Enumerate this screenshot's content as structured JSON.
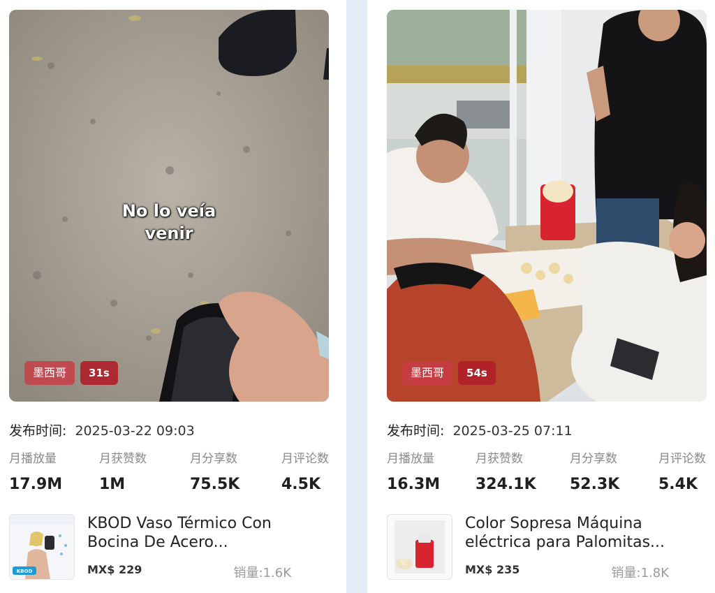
{
  "cards": [
    {
      "overlay_caption": "No lo veía\nvenir",
      "country": "墨西哥",
      "duration": "31s",
      "publish_label": "发布时间:",
      "publish_time": "2025-03-22 09:03",
      "stats": [
        {
          "label": "月播放量",
          "value": "17.9M"
        },
        {
          "label": "月获赞数",
          "value": "1M"
        },
        {
          "label": "月分享数",
          "value": "75.5K"
        },
        {
          "label": "月评论数",
          "value": "4.5K"
        }
      ],
      "product": {
        "title": "KBOD Vaso Térmico Con Bocina De Acero...",
        "price": "MX$ 229",
        "sales": "销量:1.6K",
        "image_logo": "KBOD"
      }
    },
    {
      "country": "墨西哥",
      "duration": "54s",
      "publish_label": "发布时间:",
      "publish_time": "2025-03-25 07:11",
      "stats": [
        {
          "label": "月播放量",
          "value": "16.3M"
        },
        {
          "label": "月获赞数",
          "value": "324.1K"
        },
        {
          "label": "月分享数",
          "value": "52.3K"
        },
        {
          "label": "月评论数",
          "value": "5.4K"
        }
      ],
      "product": {
        "title": "Color Sopresa Máquina eléctrica para Palomitas...",
        "price": "MX$ 235",
        "sales": "销量:1.8K"
      }
    }
  ],
  "colors": {
    "badge_country": "#c83c46",
    "badge_duration": "#af1e28",
    "divider": "#e6ecf7"
  }
}
